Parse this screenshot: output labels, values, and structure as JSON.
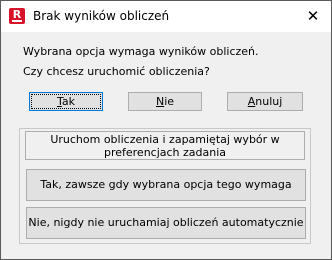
{
  "window": {
    "title": "Brak wyników obliczeń",
    "close_glyph": "✕",
    "app_icon_letter": "R",
    "app_icon_color": "#d9132a"
  },
  "message": {
    "line1": "Wybrana opcja wymaga wyników obliczeń.",
    "line2": "Czy chcesz uruchomić obliczenia?"
  },
  "buttons": {
    "yes": {
      "mnemonic": "T",
      "rest": "ak"
    },
    "no": {
      "mnemonic": "N",
      "rest": "ie"
    },
    "cancel": {
      "mnemonic": "A",
      "rest": "nuluj"
    }
  },
  "preferences": {
    "title": "Uruchom obliczenia i zapamiętaj wybór w preferencjach zadania",
    "always_label": "Tak, zawsze gdy wybrana opcja tego wymaga",
    "never_label": "Nie, nigdy nie uruchamiaj obliczeń automatycznie"
  },
  "colors": {
    "focus_border": "#0078d7",
    "button_face": "#e1e1e1",
    "dialog_background": "#f0f0f0"
  }
}
